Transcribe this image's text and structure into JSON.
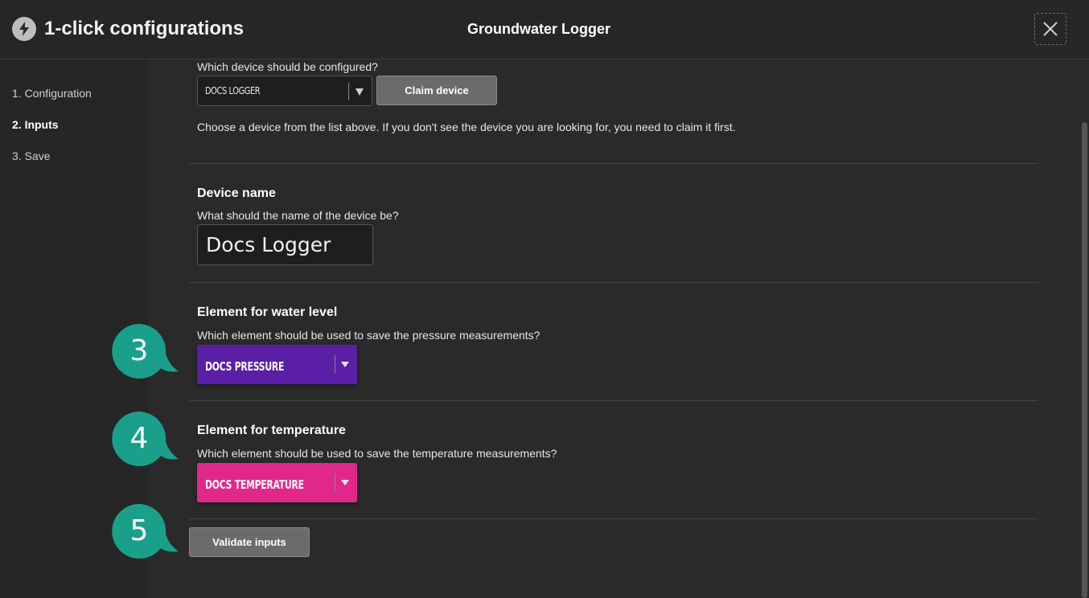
{
  "header": {
    "app_title": "1-click configurations",
    "page_title": "Groundwater Logger",
    "close_icon": "close-icon",
    "bolt_icon": "lightning-icon"
  },
  "sidebar": {
    "steps": [
      {
        "label": "1. Configuration",
        "active": false
      },
      {
        "label": "2. Inputs",
        "active": true
      },
      {
        "label": "3. Save",
        "active": false
      }
    ]
  },
  "device": {
    "question": "Which device should be configured?",
    "selected": "DOCS LOGGER",
    "claim_label": "Claim device",
    "help": "Choose a device from the list above. If you don't see the device you are looking for, you need to claim it first."
  },
  "device_name": {
    "heading": "Device name",
    "question": "What should the name of the device be?",
    "value": "Docs Logger"
  },
  "water_level": {
    "heading": "Element for water level",
    "question": "Which element should be used to save the pressure measurements?",
    "selected": "DOCS PRESSURE",
    "color": "#5a1fa6"
  },
  "temperature": {
    "heading": "Element for temperature",
    "question": "Which element should be used to save the temperature measurements?",
    "selected": "DOCS TEMPERATURE",
    "color": "#e0288a"
  },
  "validate_label": "Validate inputs",
  "callouts": [
    "3",
    "4",
    "5"
  ],
  "callout_color": "#1aa08a"
}
